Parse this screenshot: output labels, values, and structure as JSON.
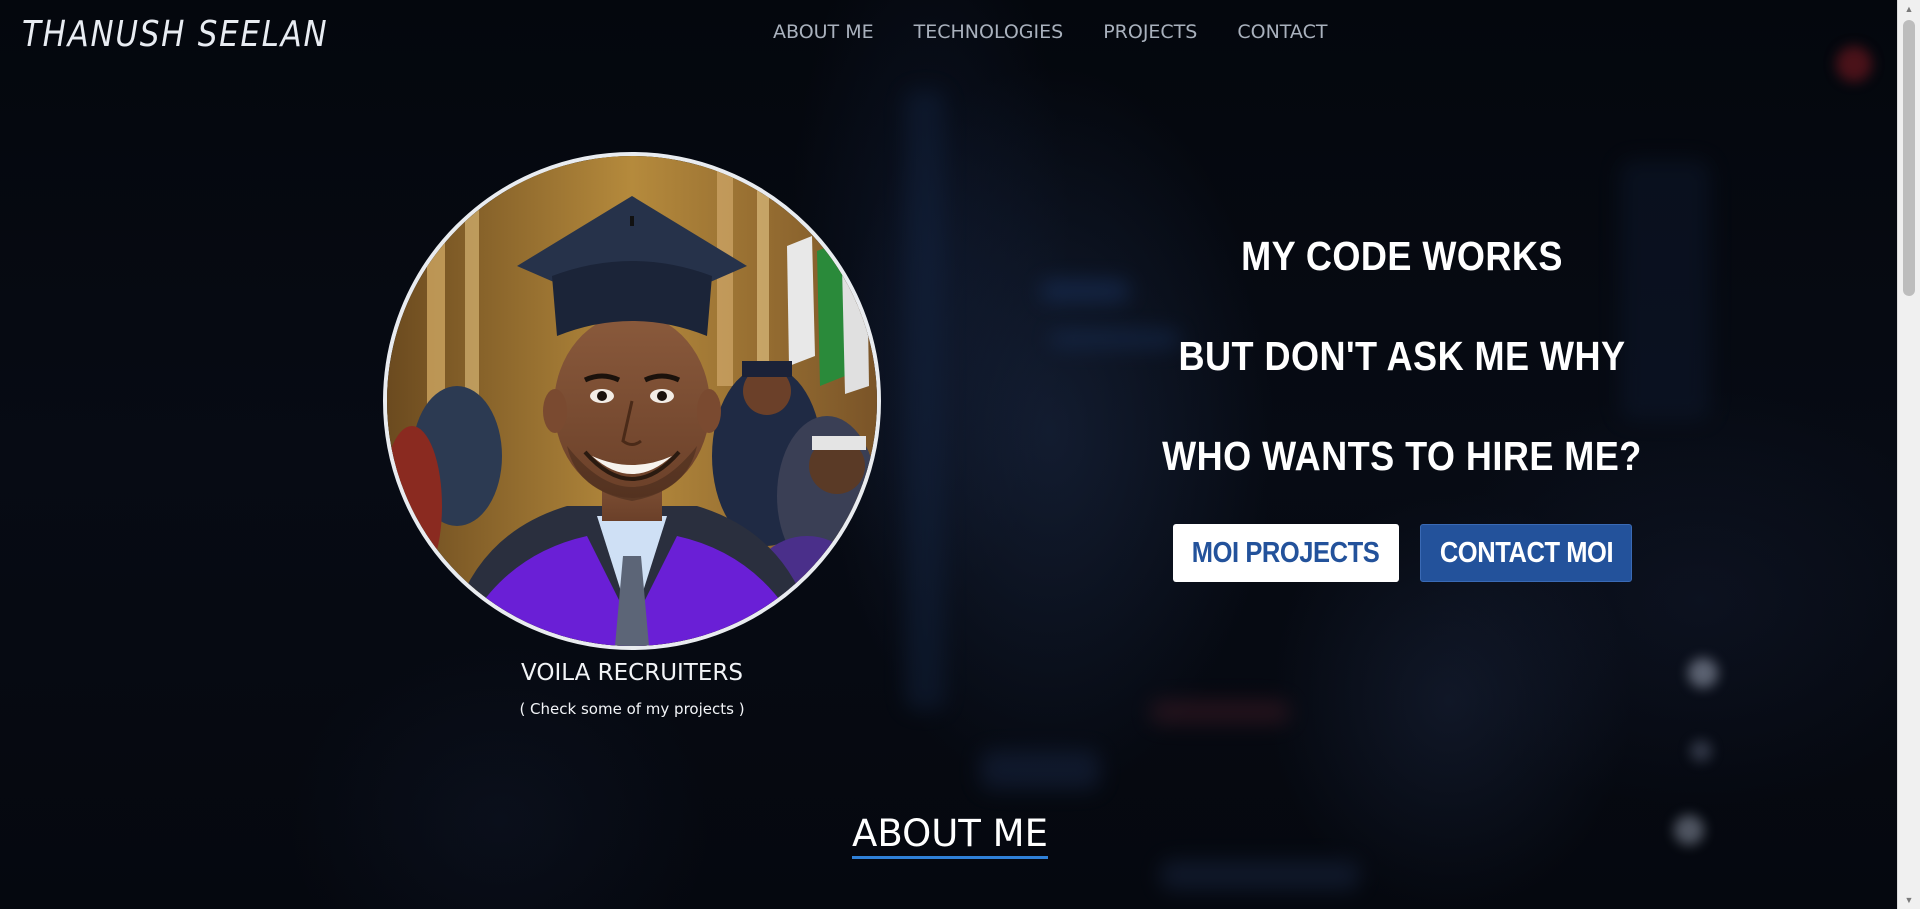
{
  "header": {
    "brand": "THANUSH SEELAN",
    "nav": [
      {
        "label": "ABOUT ME"
      },
      {
        "label": "TECHNOLOGIES"
      },
      {
        "label": "PROJECTS"
      },
      {
        "label": "CONTACT"
      }
    ]
  },
  "hero": {
    "portrait_alt": "graduation-portrait",
    "caption": "VOILA RECRUITERS",
    "subcaption": "( Check some of my projects )",
    "lines": [
      "MY CODE WORKS",
      "BUT DON'T ASK ME WHY",
      "WHO WANTS TO HIRE ME?"
    ],
    "buttons": {
      "projects_label": "MOI PROJECTS",
      "contact_label": "CONTACT MOI"
    }
  },
  "about": {
    "title": "ABOUT ME"
  },
  "colors": {
    "background": "#05080f",
    "accent_blue": "#23529b",
    "underline_blue": "#2f80d8",
    "nav_text": "#a9b1bd",
    "gown_purple": "#6a1fd6"
  }
}
